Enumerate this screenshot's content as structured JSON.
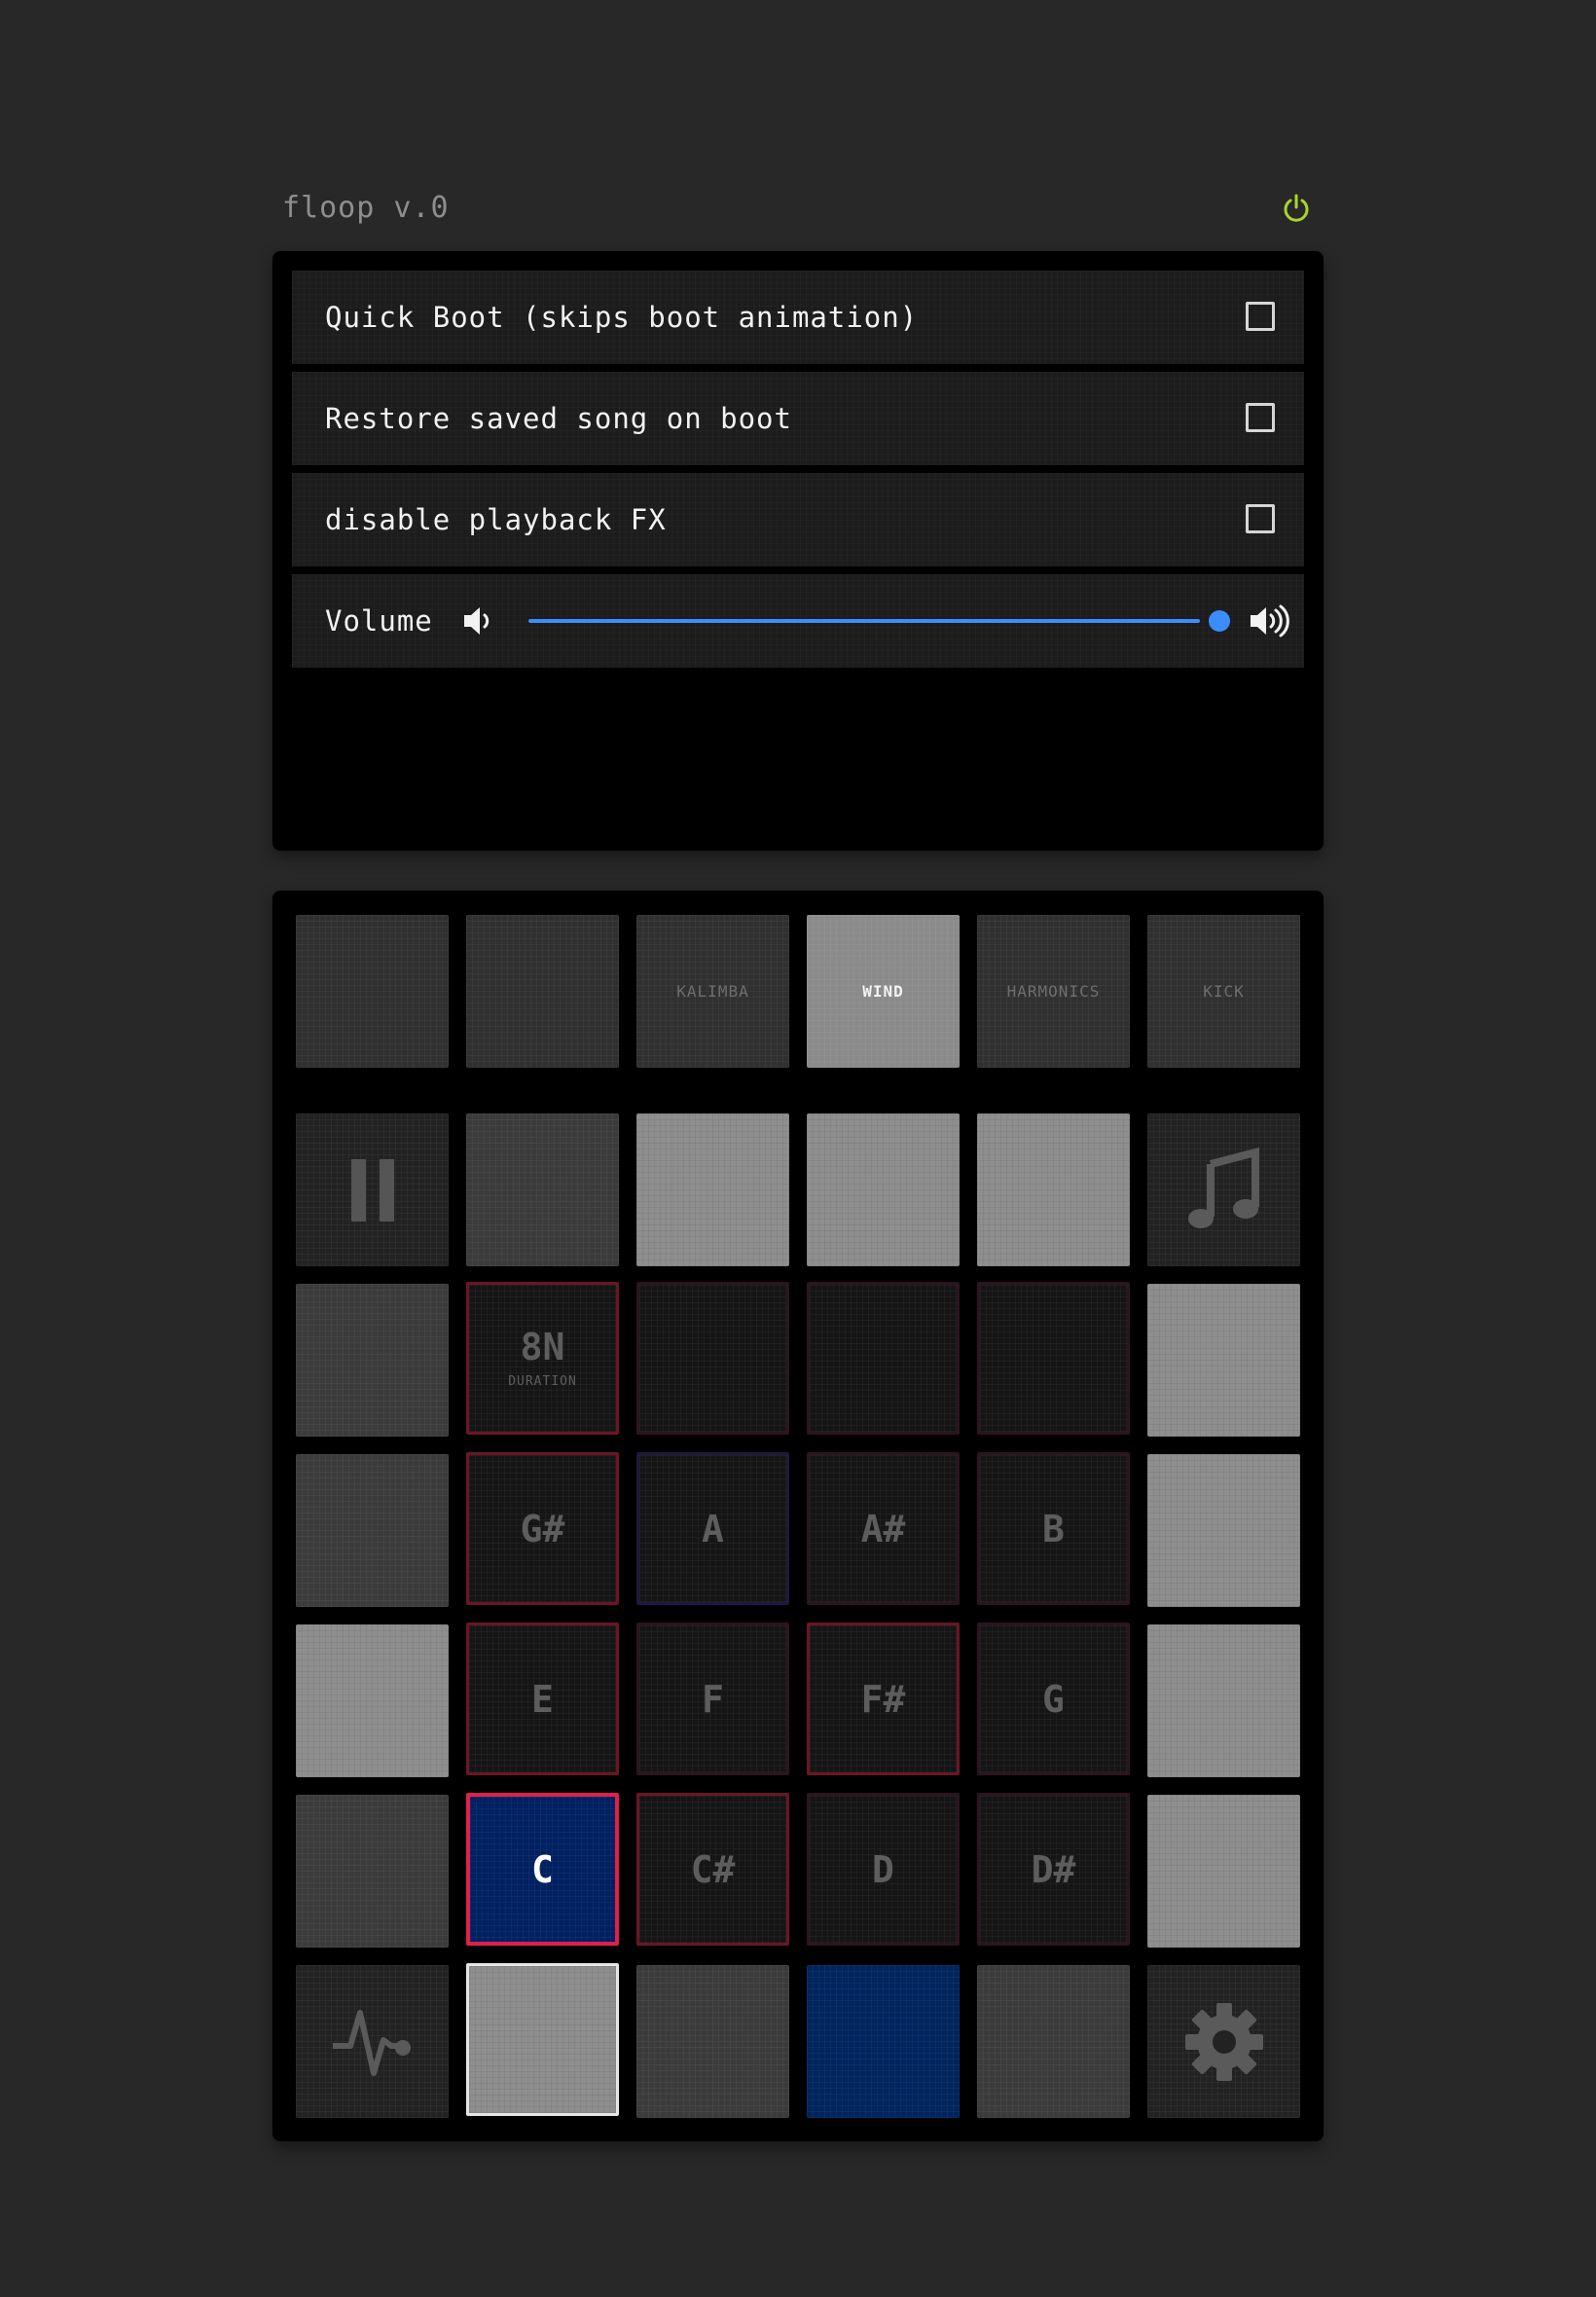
{
  "app": {
    "title": "floop v.0",
    "power_color": "#a6d62a"
  },
  "settings": {
    "quick_boot_label": "Quick Boot (skips boot animation)",
    "restore_song_label": "Restore saved song on boot",
    "disable_fx_label": "disable playback FX",
    "volume_label": "Volume",
    "volume_level": 1.0,
    "accent_color": "#3b8dff"
  },
  "instruments": [
    "",
    "",
    "KALIMBA",
    "WIND",
    "HARMONICS",
    "KICK"
  ],
  "active_instrument": "WIND",
  "duration": {
    "value": "8N",
    "caption": "DURATION"
  },
  "notes": {
    "row1": [
      "G#",
      "A",
      "A#",
      "B"
    ],
    "row2": [
      "E",
      "F",
      "F#",
      "G"
    ],
    "row3": [
      "C",
      "C#",
      "D",
      "D#"
    ]
  },
  "selected_note": "C",
  "icons": {
    "pause": "pause-icon",
    "music": "music-note-icon",
    "waveform": "waveform-icon",
    "settings": "gear-icon",
    "power": "power-icon",
    "volume_low": "speaker-low-icon",
    "volume_high": "speaker-high-icon"
  },
  "colors": {
    "selected_border": "#e0204a",
    "selected_fill": "#002060"
  }
}
